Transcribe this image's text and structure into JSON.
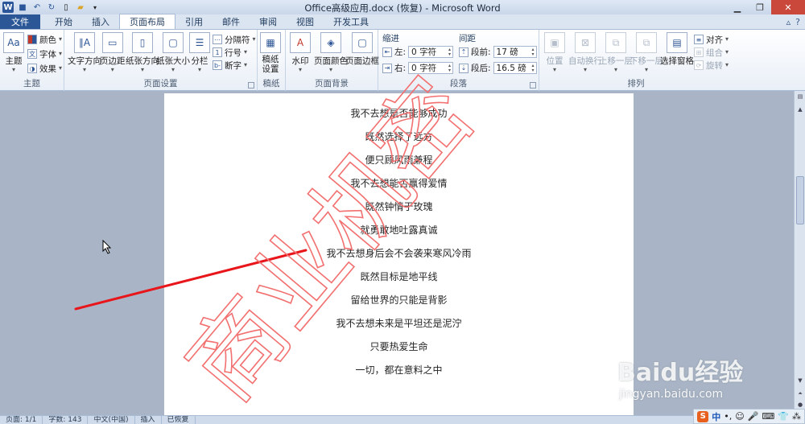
{
  "window": {
    "title": "Office高级应用.docx (恢复)  -  Microsoft Word"
  },
  "tabs": [
    "文件",
    "开始",
    "插入",
    "页面布局",
    "引用",
    "邮件",
    "审阅",
    "视图",
    "开发工具"
  ],
  "ribbon": {
    "theme": {
      "label": "主题",
      "themes_btn": "主题",
      "colors": "颜色",
      "fonts": "字体",
      "effects": "效果"
    },
    "page_setup": {
      "label": "页面设置",
      "text_dir": "文字方向",
      "margins": "页边距",
      "orientation": "纸张方向",
      "size": "纸张大小",
      "columns": "分栏",
      "breaks": "分隔符",
      "line_numbers": "行号",
      "hyphenation": "断字"
    },
    "draft": {
      "label": "稿纸",
      "btn": "稿纸\n设置"
    },
    "page_bg": {
      "label": "页面背景",
      "watermark": "水印",
      "page_color": "页面颜色",
      "page_border": "页面边框"
    },
    "paragraph": {
      "label": "段落",
      "indent": "缩进",
      "spacing": "间距",
      "left_label": "左:",
      "left_value": "0 字符",
      "right_label": "右:",
      "right_value": "0 字符",
      "before_label": "段前:",
      "before_value": "17 磅",
      "after_label": "段后:",
      "after_value": "16.5 磅"
    },
    "arrange": {
      "label": "排列",
      "position": "位置",
      "wrap": "自动换行",
      "forward": "上移一层",
      "backward": "下移一层",
      "selection_pane": "选择窗格",
      "align": "对齐",
      "group": "组合",
      "rotate": "旋转"
    }
  },
  "document": {
    "lines": [
      "我不去想是否能够成功",
      "既然选择了远方",
      "便只顾风雨兼程",
      "我不去想能否赢得爱情",
      "既然钟情于玫瑰",
      "就勇敢地吐露真诚",
      "我不去想身后会不会袭来寒风冷雨",
      "既然目标是地平线",
      "留给世界的只能是背影",
      "我不去想未来是平坦还是泥泞",
      "只要热爱生命",
      "一切，都在意料之中"
    ],
    "watermark_text": "商业机密",
    "watermark_color": "#f27070"
  },
  "status": {
    "page": "页面: 1/1",
    "words": "字数: 143",
    "lang": "中文(中国)",
    "mode": "插入",
    "recovered": "已恢复"
  },
  "tray": {
    "ime": "中"
  },
  "brand": {
    "main": "Baidu经验",
    "sub": "jingyan.baidu.com"
  }
}
